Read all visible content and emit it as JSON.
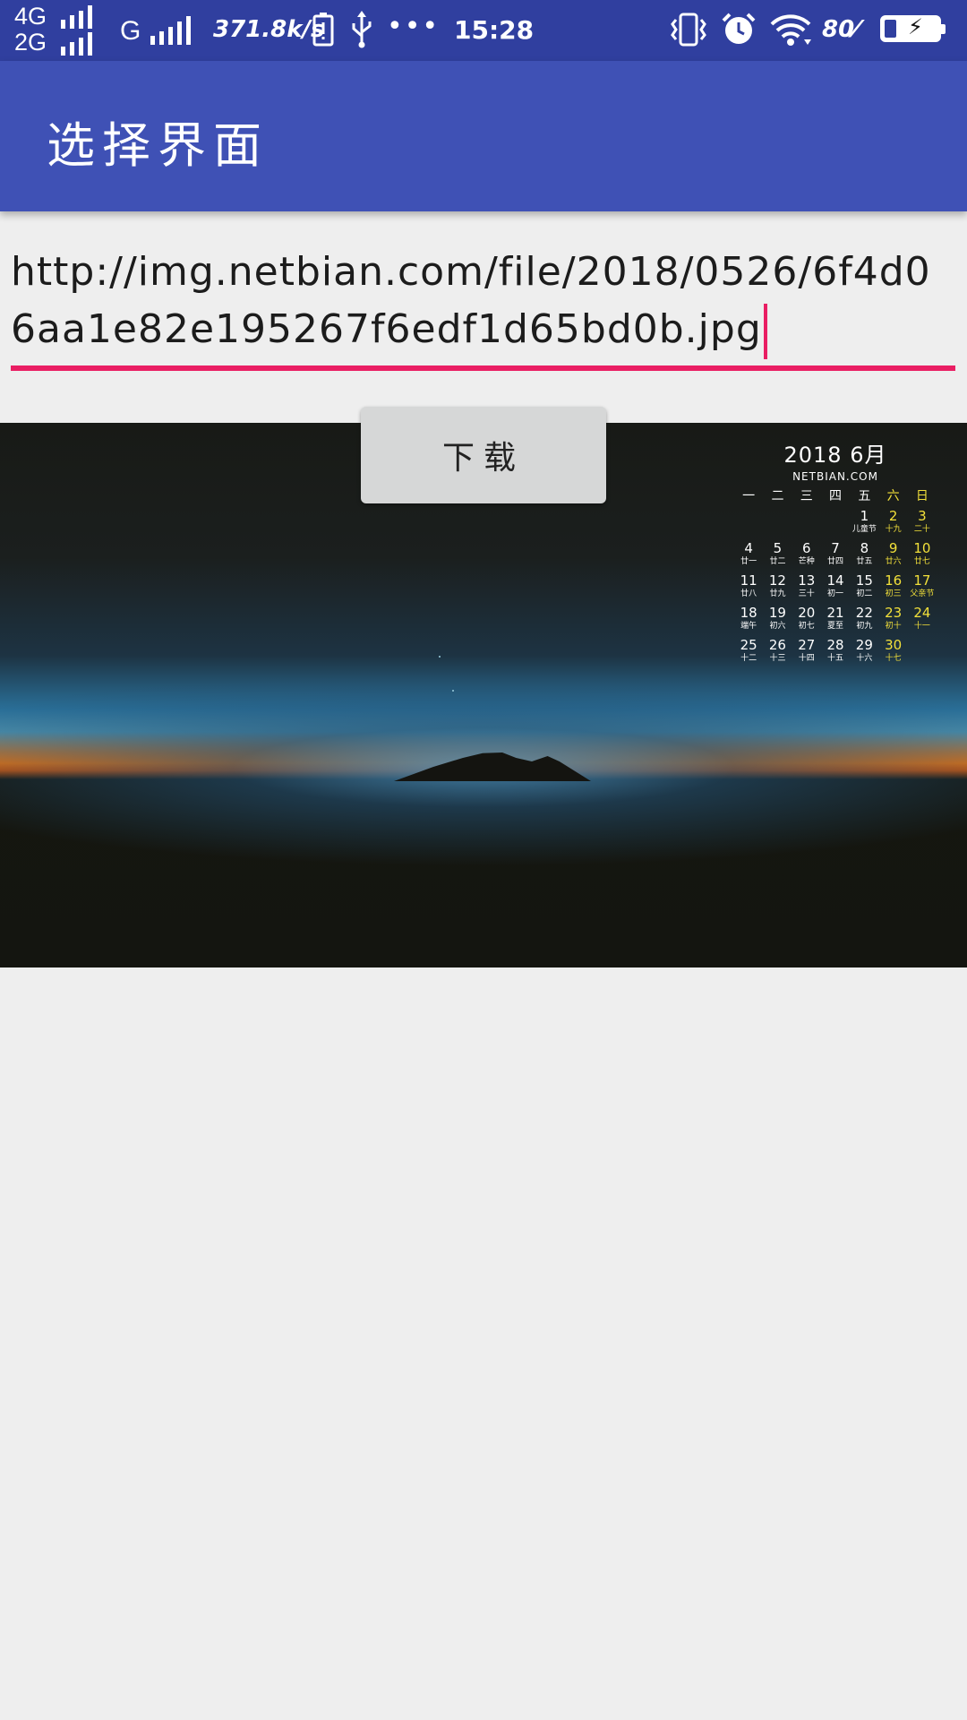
{
  "status_bar": {
    "network_top": "4G",
    "network_bottom": "2G",
    "network_g": "G",
    "speed": "371.8k/s",
    "dots": "•••",
    "time": "15:28",
    "battery_percent": "80",
    "icons": [
      "signal-icon",
      "warning-icon",
      "usb-icon",
      "vibrate-icon",
      "alarm-icon",
      "wifi-icon",
      "battery-icon"
    ]
  },
  "app_bar": {
    "title": "选择界面",
    "color": "#3f51b5"
  },
  "url_field": {
    "value": "http://img.netbian.com/file/2018/0526/6f4d06aa1e82e195267f6edf1d65bd0b.jpg",
    "underline_color": "#e91e63"
  },
  "download_button": {
    "label": "下载"
  },
  "image_calendar": {
    "title": "2018  6月",
    "site": "NETBIAN.COM",
    "weekdays": [
      "一",
      "二",
      "三",
      "四",
      "五",
      "六",
      "日"
    ],
    "weeks": [
      [
        null,
        null,
        null,
        null,
        {
          "d": "1",
          "l": "儿童节"
        },
        {
          "d": "2",
          "l": "十九"
        },
        {
          "d": "3",
          "l": "二十"
        }
      ],
      [
        {
          "d": "4",
          "l": "廿一"
        },
        {
          "d": "5",
          "l": "廿二"
        },
        {
          "d": "6",
          "l": "芒种"
        },
        {
          "d": "7",
          "l": "廿四"
        },
        {
          "d": "8",
          "l": "廿五"
        },
        {
          "d": "9",
          "l": "廿六"
        },
        {
          "d": "10",
          "l": "廿七"
        }
      ],
      [
        {
          "d": "11",
          "l": "廿八"
        },
        {
          "d": "12",
          "l": "廿九"
        },
        {
          "d": "13",
          "l": "三十"
        },
        {
          "d": "14",
          "l": "初一"
        },
        {
          "d": "15",
          "l": "初二"
        },
        {
          "d": "16",
          "l": "初三"
        },
        {
          "d": "17",
          "l": "父亲节"
        }
      ],
      [
        {
          "d": "18",
          "l": "端午"
        },
        {
          "d": "19",
          "l": "初六"
        },
        {
          "d": "20",
          "l": "初七"
        },
        {
          "d": "21",
          "l": "夏至"
        },
        {
          "d": "22",
          "l": "初九"
        },
        {
          "d": "23",
          "l": "初十"
        },
        {
          "d": "24",
          "l": "十一"
        }
      ],
      [
        {
          "d": "25",
          "l": "十二"
        },
        {
          "d": "26",
          "l": "十三"
        },
        {
          "d": "27",
          "l": "十四"
        },
        {
          "d": "28",
          "l": "十五"
        },
        {
          "d": "29",
          "l": "十六"
        },
        {
          "d": "30",
          "l": "十七"
        },
        null
      ]
    ],
    "weekend_color": "#f2e03a"
  }
}
